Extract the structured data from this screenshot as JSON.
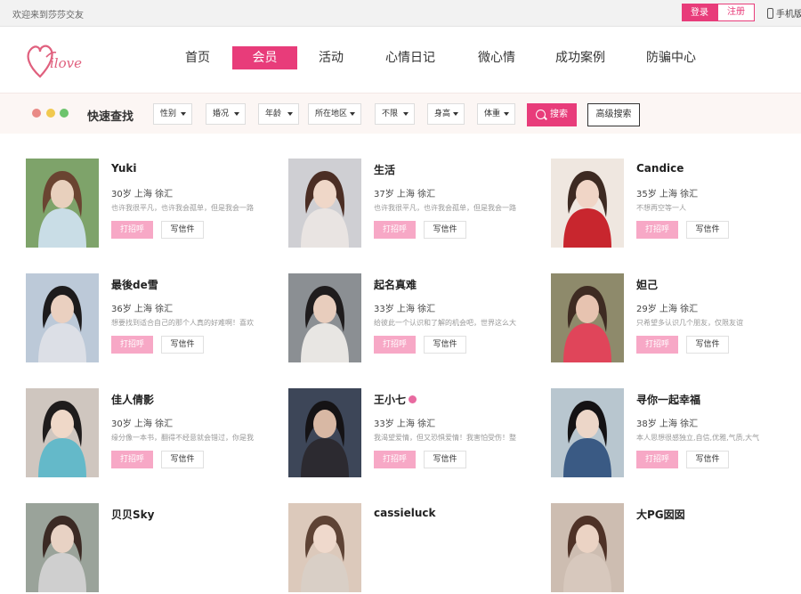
{
  "topbar": {
    "welcome": "欢迎来到莎莎交友",
    "login": "登录",
    "register": "注册",
    "mobile": "手机版"
  },
  "logo": {
    "text": "ilove"
  },
  "nav": {
    "items": [
      {
        "label": "首页"
      },
      {
        "label": "会员"
      },
      {
        "label": "活动"
      },
      {
        "label": "心情日记"
      },
      {
        "label": "微心情"
      },
      {
        "label": "成功案例"
      },
      {
        "label": "防骗中心"
      }
    ],
    "active": "会员"
  },
  "search": {
    "title": "快速查找",
    "filters": [
      {
        "label": "性别"
      },
      {
        "label": "婚况"
      },
      {
        "label": "年龄"
      },
      {
        "label": "所在地区"
      },
      {
        "label": "不限"
      },
      {
        "label": "身高"
      },
      {
        "label": "体重"
      }
    ],
    "search_button": "搜索",
    "advanced_button": "高级搜索"
  },
  "colors": {
    "accent": "#e83c7a",
    "greet_bg": "#f7a8c6",
    "dots": [
      "#e98a86",
      "#f1c94f",
      "#6cc36c"
    ]
  },
  "buttons": {
    "greet": "打招呼",
    "letter": "写信件"
  },
  "members": [
    {
      "name": "Yuki",
      "info": "30岁 上海 徐汇",
      "bio": "也许我很平凡，也许我会孤单，但是我会一路"
    },
    {
      "name": "生活",
      "info": "37岁 上海 徐汇",
      "bio": "也许我很平凡，也许我会孤单，但是我会一路"
    },
    {
      "name": "Candice",
      "info": "35岁 上海 徐汇",
      "bio": "不想再空等一人"
    },
    {
      "name": "最後de雪",
      "info": "36岁 上海 徐汇",
      "bio": "想要找到适合自己的那个人真的好难啊！喜欢"
    },
    {
      "name": "起名真难",
      "info": "33岁 上海 徐汇",
      "bio": "给彼此一个认识和了解的机会吧，世界这么大"
    },
    {
      "name": "妲己",
      "info": "29岁 上海 徐汇",
      "bio": "只希望多认识几个朋友，仅限友谊"
    },
    {
      "name": "佳人倩影",
      "info": "30岁 上海 徐汇",
      "bio": "缘分像一本书，翻得不经意就会错过，你是我"
    },
    {
      "name": "王小七",
      "info": "33岁 上海 徐汇",
      "bio": "我渴望爱情，但又恐惧爱情！我害怕受伤！整"
    },
    {
      "name": "寻你一起幸福",
      "info": "38岁 上海 徐汇",
      "bio": "本人思想很感独立,自信,优雅,气质,大气"
    },
    {
      "name": "贝贝Sky",
      "info": "",
      "bio": ""
    },
    {
      "name": "cassieluck",
      "info": "",
      "bio": ""
    },
    {
      "name": "大PG囡囡",
      "info": "",
      "bio": ""
    }
  ]
}
